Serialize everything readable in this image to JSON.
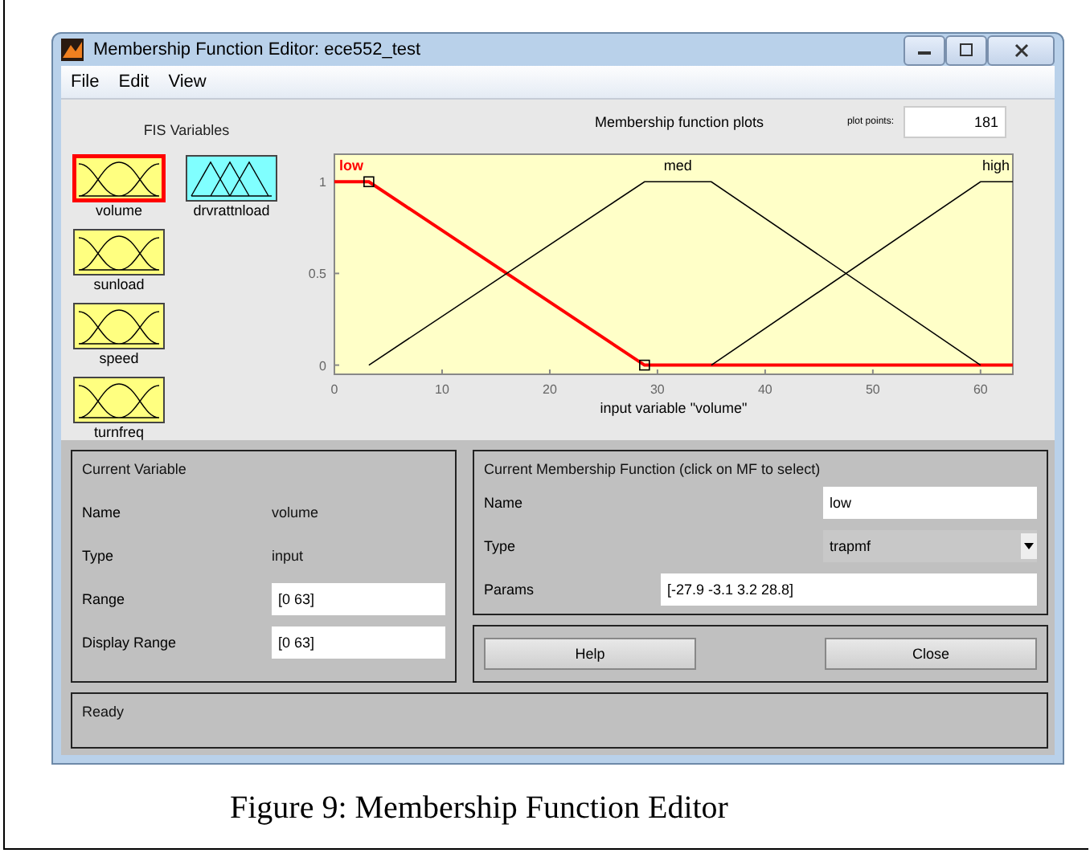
{
  "window": {
    "title": "Membership Function Editor: ece552_test"
  },
  "menu": [
    "File",
    "Edit",
    "View"
  ],
  "fis_variables": {
    "title": "FIS Variables",
    "inputs": [
      {
        "name": "volume",
        "selected": true
      },
      {
        "name": "sunload",
        "selected": false
      },
      {
        "name": "speed",
        "selected": false
      },
      {
        "name": "turnfreq",
        "selected": false
      }
    ],
    "outputs": [
      {
        "name": "drvrattnload",
        "selected": false
      }
    ]
  },
  "plot": {
    "title": "Membership function plots",
    "plot_points_label": "plot points:",
    "plot_points": "181",
    "chart_data": {
      "type": "line",
      "xlabel": "input variable \"volume\"",
      "x": [
        0,
        3.2,
        28.8,
        35,
        60,
        63
      ],
      "series": [
        {
          "name": "low",
          "color": "#ff0000",
          "values": [
            1,
            1,
            0,
            0,
            0,
            0
          ]
        },
        {
          "name": "med",
          "color": "#000000",
          "values": [
            null,
            0,
            1,
            1,
            0,
            null
          ]
        },
        {
          "name": "high",
          "color": "#000000",
          "values": [
            null,
            null,
            null,
            0,
            1,
            1
          ]
        }
      ],
      "xlim": [
        0,
        63
      ],
      "ylim": [
        -0.05,
        1.15
      ],
      "xticks": [
        0,
        10,
        20,
        30,
        40,
        50,
        60
      ],
      "yticks": [
        0,
        0.5,
        1
      ]
    },
    "curves": [
      {
        "selected": true
      },
      {
        "selected": false
      },
      {
        "selected": false
      }
    ]
  },
  "current_variable": {
    "title": "Current Variable",
    "rows": [
      {
        "kind": "text",
        "label": "Name",
        "value": "volume"
      },
      {
        "kind": "text",
        "label": "Type",
        "value": "input"
      },
      {
        "kind": "field",
        "label": "Range",
        "value": "[0 63]"
      },
      {
        "kind": "field",
        "label": "Display Range",
        "value": "[0 63]"
      }
    ]
  },
  "current_mf": {
    "title": "Current Membership Function (click on MF to select)",
    "rows": [
      {
        "kind": "field",
        "label": "Name",
        "value": "low"
      },
      {
        "kind": "dropdown",
        "label": "Type",
        "value": "trapmf"
      },
      {
        "kind": "wide",
        "label": "Params",
        "value": "[-27.9 -3.1 3.2 28.8]"
      }
    ]
  },
  "buttons": [
    "Help",
    "Close"
  ],
  "status": "Ready",
  "caption": "Figure 9: Membership Function Editor"
}
